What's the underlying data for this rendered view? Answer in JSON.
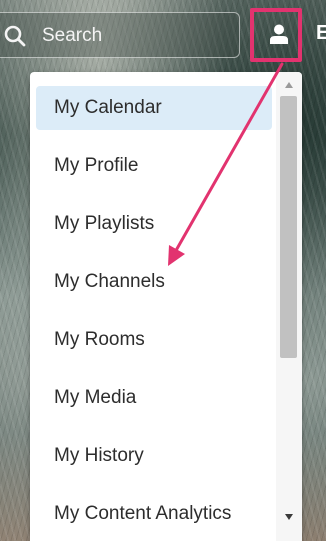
{
  "search": {
    "placeholder_text": "Search",
    "icon": "search-icon"
  },
  "header": {
    "user_icon": "user-icon",
    "cut_text": "E"
  },
  "menu": {
    "items": [
      {
        "label": "My Calendar",
        "active": true
      },
      {
        "label": "My Profile",
        "active": false
      },
      {
        "label": "My Playlists",
        "active": false
      },
      {
        "label": "My Channels",
        "active": false
      },
      {
        "label": "My Rooms",
        "active": false
      },
      {
        "label": "My Media",
        "active": false
      },
      {
        "label": "My History",
        "active": false
      },
      {
        "label": "My Content Analytics",
        "active": false
      }
    ]
  },
  "scrollbar": {
    "up_icon": "scroll-up-arrow-icon",
    "down_icon": "scroll-down-arrow-icon"
  },
  "annotation": {
    "color": "#e2336f",
    "highlight": "user-button",
    "points_to": "My Channels"
  },
  "colors": {
    "active_item_bg": "#dcecf8",
    "highlight_box": "#e2336f",
    "menu_text": "#2d2d2d"
  }
}
